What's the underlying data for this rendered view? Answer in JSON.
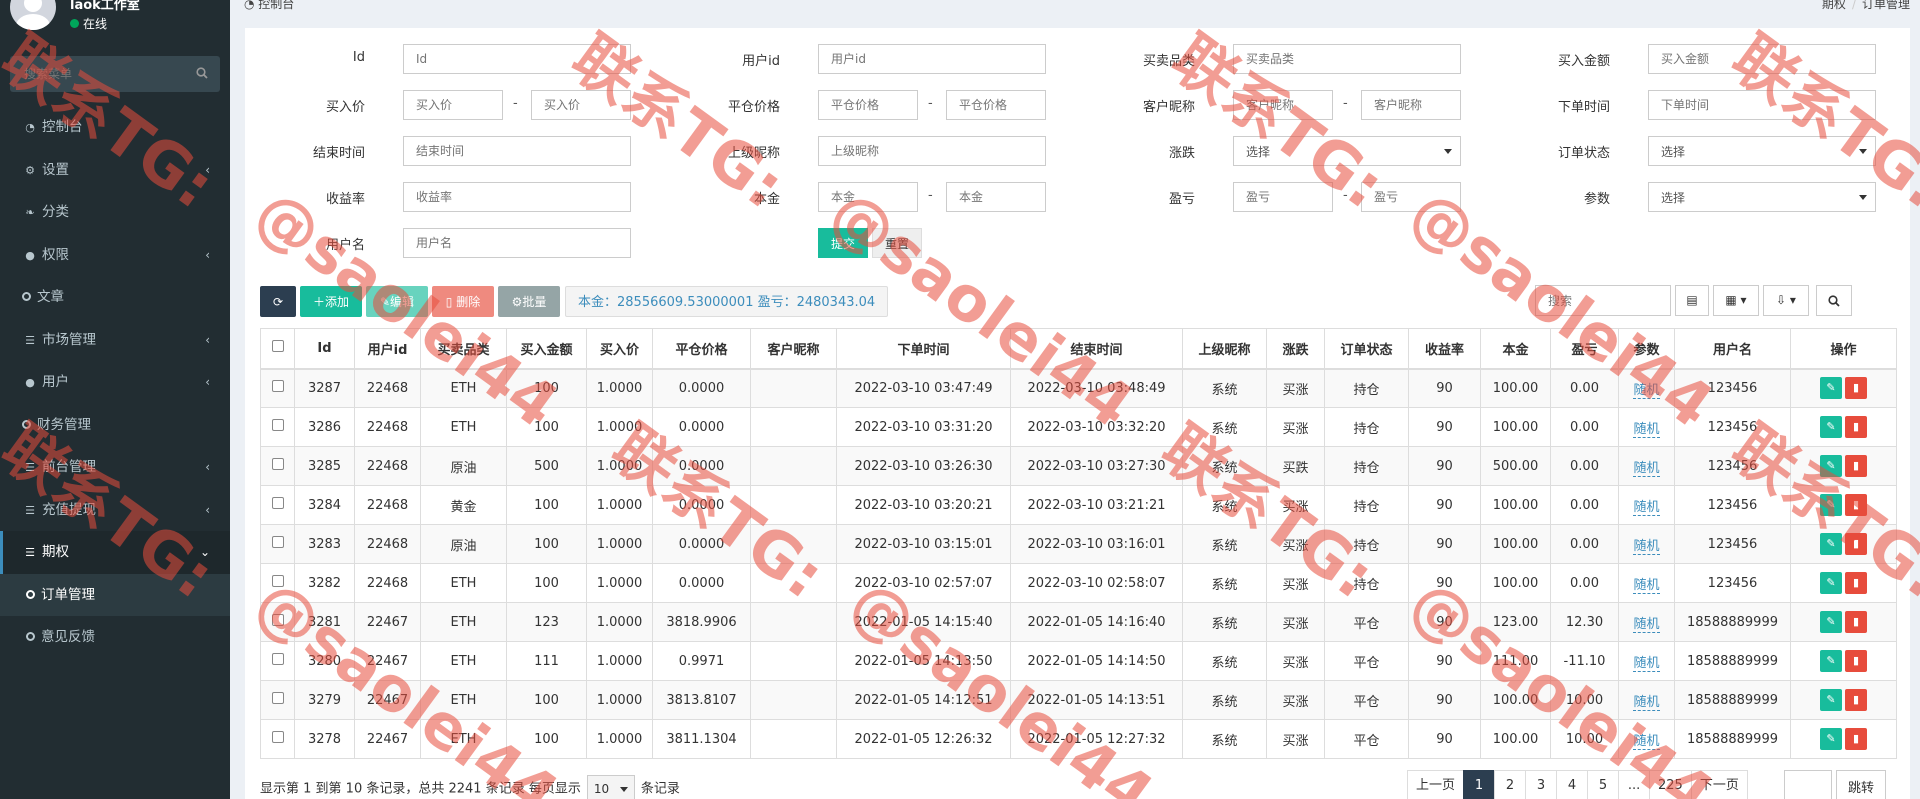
{
  "user": {
    "name": "laok工作室",
    "status": "在线"
  },
  "sidebar": {
    "search_placeholder": "搜索菜单",
    "items": [
      {
        "label": "控制台",
        "icon": "dashboard-icon",
        "chevron": false
      },
      {
        "label": "设置",
        "icon": "cogs-icon",
        "chevron": true
      },
      {
        "label": "分类",
        "icon": "leaf-icon",
        "chevron": false
      },
      {
        "label": "权限",
        "icon": "group-icon",
        "chevron": true
      },
      {
        "label": "文章",
        "icon": "circle-icon",
        "chevron": false
      },
      {
        "label": "市场管理",
        "icon": "list-icon",
        "chevron": true
      },
      {
        "label": "用户",
        "icon": "user-icon",
        "chevron": true
      },
      {
        "label": "财务管理",
        "icon": "circle-icon",
        "chevron": false
      },
      {
        "label": "前台管理",
        "icon": "list-icon",
        "chevron": true
      },
      {
        "label": "充值提现",
        "icon": "list-icon",
        "chevron": true
      },
      {
        "label": "期权",
        "icon": "list-icon",
        "chevron": true
      },
      {
        "label": "订单管理",
        "icon": "circle-icon",
        "chevron": false
      },
      {
        "label": "意见反馈",
        "icon": "circle-icon",
        "chevron": false
      }
    ]
  },
  "breadcrumb": {
    "left": "控制台",
    "right": [
      "期权",
      "订单管理"
    ]
  },
  "filters": {
    "id": {
      "label": "Id",
      "placeholder": "Id"
    },
    "user_id": {
      "label": "用户id",
      "placeholder": "用户id"
    },
    "product": {
      "label": "买卖品类",
      "placeholder": "买卖品类"
    },
    "amount": {
      "label": "买入金额",
      "placeholder": "买入金额"
    },
    "buy_price": {
      "label": "买入价",
      "placeholder_from": "买入价",
      "placeholder_to": "买入价"
    },
    "close_price": {
      "label": "平仓价格",
      "placeholder_from": "平仓价格",
      "placeholder_to": "平仓价格"
    },
    "nickname": {
      "label": "客户昵称",
      "placeholder_from": "客户昵称",
      "placeholder_to": "客户昵称"
    },
    "order_time": {
      "label": "下单时间",
      "placeholder": "下单时间"
    },
    "end_time": {
      "label": "结束时间",
      "placeholder": "结束时间"
    },
    "parent_nick": {
      "label": "上级昵称",
      "placeholder": "上级昵称"
    },
    "direction": {
      "label": "涨跌",
      "value": "选择"
    },
    "order_status": {
      "label": "订单状态",
      "value": "选择"
    },
    "yield": {
      "label": "收益率",
      "placeholder": "收益率"
    },
    "principal": {
      "label": "本金",
      "placeholder_from": "本金",
      "placeholder_to": "本金"
    },
    "profit": {
      "label": "盈亏",
      "placeholder_from": "盈亏",
      "placeholder_to": "盈亏"
    },
    "param": {
      "label": "参数",
      "value": "选择"
    },
    "username": {
      "label": "用户名",
      "placeholder": "用户名"
    },
    "dash": "-",
    "submit": "提交",
    "reset": "重置"
  },
  "toolbar": {
    "add": "添加",
    "edit": "编辑",
    "delete": "删除",
    "batch": "批量",
    "summary": "本金：28556609.53000001 盈亏：2480343.04",
    "search_placeholder": "搜索"
  },
  "table": {
    "headers": [
      "Id",
      "用户id",
      "买卖品类",
      "买入金额",
      "买入价",
      "平仓价格",
      "客户昵称",
      "下单时间",
      "结束时间",
      "上级昵称",
      "涨跌",
      "订单状态",
      "收益率",
      "本金",
      "盈亏",
      "参数",
      "用户名",
      "操作"
    ],
    "rows": [
      [
        "3287",
        "22468",
        "ETH",
        "100",
        "1.0000",
        "0.0000",
        "",
        "2022-03-10 03:47:49",
        "2022-03-10 03:48:49",
        "系统",
        "买涨",
        "持仓",
        "90",
        "100.00",
        "0.00",
        "随机",
        "123456"
      ],
      [
        "3286",
        "22468",
        "ETH",
        "100",
        "1.0000",
        "0.0000",
        "",
        "2022-03-10 03:31:20",
        "2022-03-10 03:32:20",
        "系统",
        "买涨",
        "持仓",
        "90",
        "100.00",
        "0.00",
        "随机",
        "123456"
      ],
      [
        "3285",
        "22468",
        "原油",
        "500",
        "1.0000",
        "0.0000",
        "",
        "2022-03-10 03:26:30",
        "2022-03-10 03:27:30",
        "系统",
        "买跌",
        "持仓",
        "90",
        "500.00",
        "0.00",
        "随机",
        "123456"
      ],
      [
        "3284",
        "22468",
        "黄金",
        "100",
        "1.0000",
        "0.0000",
        "",
        "2022-03-10 03:20:21",
        "2022-03-10 03:21:21",
        "系统",
        "买涨",
        "持仓",
        "90",
        "100.00",
        "0.00",
        "随机",
        "123456"
      ],
      [
        "3283",
        "22468",
        "原油",
        "100",
        "1.0000",
        "0.0000",
        "",
        "2022-03-10 03:15:01",
        "2022-03-10 03:16:01",
        "系统",
        "买涨",
        "持仓",
        "90",
        "100.00",
        "0.00",
        "随机",
        "123456"
      ],
      [
        "3282",
        "22468",
        "ETH",
        "100",
        "1.0000",
        "0.0000",
        "",
        "2022-03-10 02:57:07",
        "2022-03-10 02:58:07",
        "系统",
        "买涨",
        "持仓",
        "90",
        "100.00",
        "0.00",
        "随机",
        "123456"
      ],
      [
        "3281",
        "22467",
        "ETH",
        "123",
        "1.0000",
        "3818.9906",
        "",
        "2022-01-05 14:15:40",
        "2022-01-05 14:16:40",
        "系统",
        "买涨",
        "平仓",
        "90",
        "123.00",
        "12.30",
        "随机",
        "18588889999"
      ],
      [
        "3280",
        "22467",
        "ETH",
        "111",
        "1.0000",
        "0.9971",
        "",
        "2022-01-05 14:13:50",
        "2022-01-05 14:14:50",
        "系统",
        "买涨",
        "平仓",
        "90",
        "111.00",
        "-11.10",
        "随机",
        "18588889999"
      ],
      [
        "3279",
        "22467",
        "ETH",
        "100",
        "1.0000",
        "3813.8107",
        "",
        "2022-01-05 14:12:51",
        "2022-01-05 14:13:51",
        "系统",
        "买涨",
        "平仓",
        "90",
        "100.00",
        "10.00",
        "随机",
        "18588889999"
      ],
      [
        "3278",
        "22467",
        "ETH",
        "100",
        "1.0000",
        "3811.1304",
        "",
        "2022-01-05 12:26:32",
        "2022-01-05 12:27:32",
        "系统",
        "买涨",
        "平仓",
        "90",
        "100.00",
        "10.00",
        "随机",
        "18588889999"
      ]
    ]
  },
  "footer": {
    "info_prefix": "显示第 1 到第 10 条记录，总共 2241 条记录 每页显示",
    "page_size": "10",
    "info_suffix": "条记录",
    "prev": "上一页",
    "pages": [
      "1",
      "2",
      "3",
      "4",
      "5",
      "...",
      "225"
    ],
    "next": "下一页",
    "jump": "跳转"
  },
  "watermark": {
    "line1": "联系TG:",
    "line2": "@saolei44"
  },
  "colors": {
    "sidebar": "#222d32",
    "accent": "#18bc9c",
    "danger": "#e74c3c",
    "primary": "#2c3e50",
    "link": "#3c8dbc"
  }
}
